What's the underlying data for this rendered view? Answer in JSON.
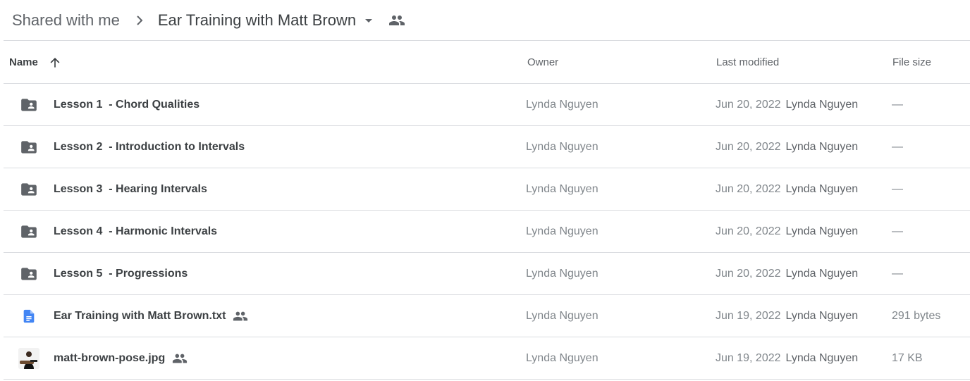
{
  "breadcrumb": {
    "root": "Shared with me",
    "current": "Ear Training with Matt Brown"
  },
  "columns": {
    "name": "Name",
    "owner": "Owner",
    "last_modified": "Last modified",
    "file_size": "File size"
  },
  "rows": [
    {
      "name": "Lesson 1  - Chord Qualities",
      "type": "shared-folder-icon",
      "owner": "Lynda Nguyen",
      "date": "Jun 20, 2022",
      "modified_by": "Lynda Nguyen",
      "size": "—"
    },
    {
      "name": "Lesson 2  - Introduction to Intervals",
      "type": "shared-folder-icon",
      "owner": "Lynda Nguyen",
      "date": "Jun 20, 2022",
      "modified_by": "Lynda Nguyen",
      "size": "—"
    },
    {
      "name": "Lesson 3  - Hearing Intervals",
      "type": "shared-folder-icon",
      "owner": "Lynda Nguyen",
      "date": "Jun 20, 2022",
      "modified_by": "Lynda Nguyen",
      "size": "—"
    },
    {
      "name": "Lesson 4  - Harmonic Intervals",
      "type": "shared-folder-icon",
      "owner": "Lynda Nguyen",
      "date": "Jun 20, 2022",
      "modified_by": "Lynda Nguyen",
      "size": "—"
    },
    {
      "name": "Lesson 5  - Progressions",
      "type": "shared-folder-icon",
      "owner": "Lynda Nguyen",
      "date": "Jun 20, 2022",
      "modified_by": "Lynda Nguyen",
      "size": "—"
    },
    {
      "name": "Ear Training with Matt Brown.txt",
      "type": "document-icon",
      "owner": "Lynda Nguyen",
      "date": "Jun 19, 2022",
      "modified_by": "Lynda Nguyen",
      "size": "291 bytes",
      "shared": true
    },
    {
      "name": "matt-brown-pose.jpg",
      "type": "image-thumbnail",
      "owner": "Lynda Nguyen",
      "date": "Jun 19, 2022",
      "modified_by": "Lynda Nguyen",
      "size": "17 KB",
      "shared": true
    }
  ],
  "colors": {
    "doc_blue": "#4285f4",
    "icon_gray": "#5f6368",
    "divider": "#dadce0"
  }
}
